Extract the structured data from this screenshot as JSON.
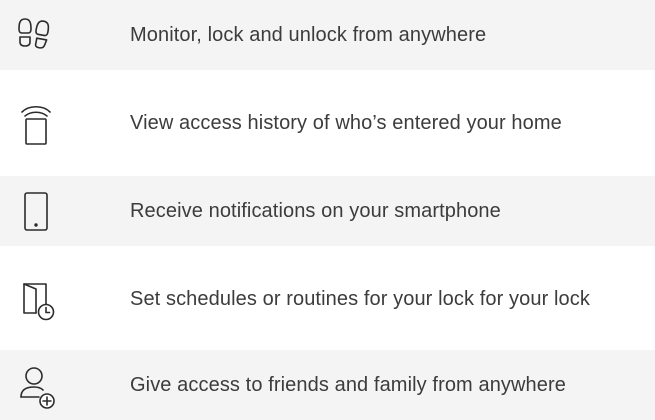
{
  "features": [
    {
      "icon": "footprints-icon",
      "label": "Monitor, lock and unlock from anywhere",
      "highlighted": true
    },
    {
      "icon": "smart-lock-icon",
      "label": "View access history of who’s entered your home",
      "highlighted": false
    },
    {
      "icon": "smartphone-icon",
      "label": "Receive notifications on your smartphone",
      "highlighted": true
    },
    {
      "icon": "door-schedule-icon",
      "label": "Set schedules or routines for your lock for your lock",
      "highlighted": false
    },
    {
      "icon": "add-user-icon",
      "label": "Give access to friends and family from anywhere",
      "highlighted": true
    }
  ],
  "colors": {
    "stripe": "#f4f4f4",
    "icon_stroke": "#2b2b2b",
    "text": "#3c3c3c"
  }
}
